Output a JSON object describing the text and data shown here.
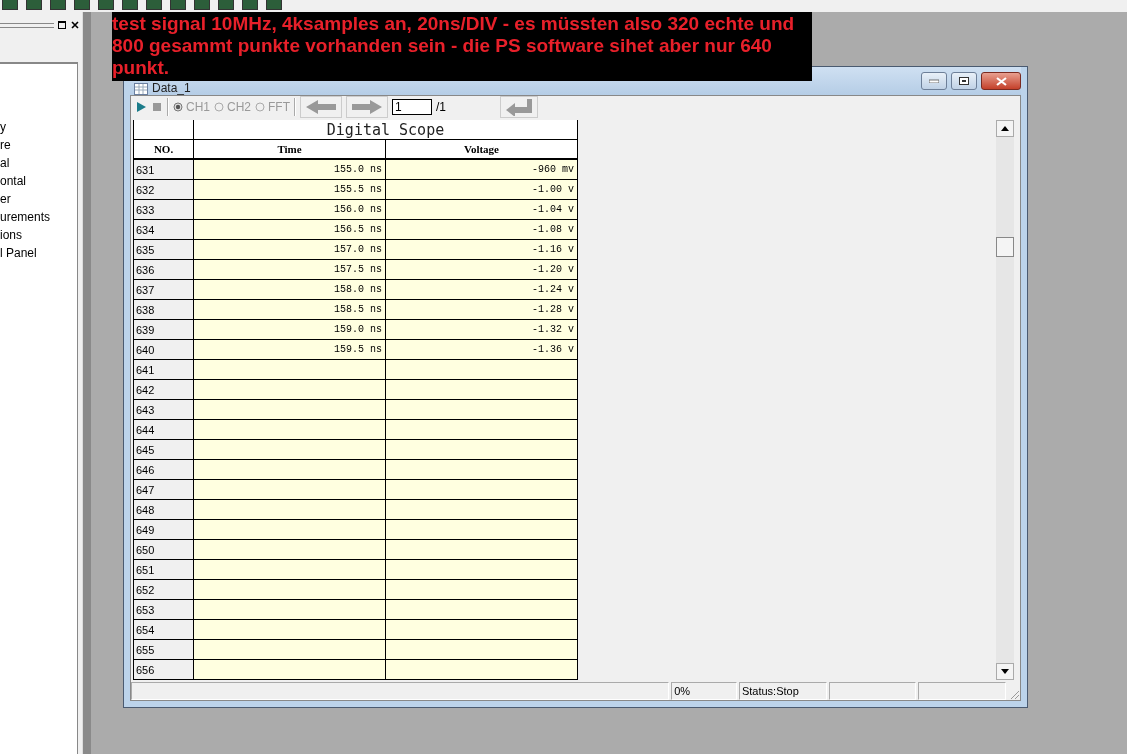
{
  "note": {
    "text": "test signal 10MHz, 4ksamples an, 20ns/DIV - es müssten also 320 echte und 800 gesammt punkte vorhanden sein - die PS software sihet aber nur 640 punkt."
  },
  "sidebar": {
    "items": [
      "y",
      "re",
      "al",
      "ontal",
      "er",
      "urements",
      "ions",
      "l Panel"
    ]
  },
  "window": {
    "title": "Data_1",
    "toolbar": {
      "channels": [
        {
          "label": "CH1",
          "selected": true
        },
        {
          "label": "CH2",
          "selected": false
        },
        {
          "label": "FFT",
          "selected": false
        }
      ],
      "page_value": "1",
      "page_total": "/1"
    },
    "table": {
      "title": "Digital Scope",
      "columns": [
        "NO.",
        "Time",
        "Voltage"
      ],
      "rows": [
        {
          "no": "631",
          "time": "155.0 ns",
          "voltage": "-960 mv"
        },
        {
          "no": "632",
          "time": "155.5 ns",
          "voltage": "-1.00 v"
        },
        {
          "no": "633",
          "time": "156.0 ns",
          "voltage": "-1.04 v"
        },
        {
          "no": "634",
          "time": "156.5 ns",
          "voltage": "-1.08 v"
        },
        {
          "no": "635",
          "time": "157.0 ns",
          "voltage": "-1.16 v"
        },
        {
          "no": "636",
          "time": "157.5 ns",
          "voltage": "-1.20 v"
        },
        {
          "no": "637",
          "time": "158.0 ns",
          "voltage": "-1.24 v"
        },
        {
          "no": "638",
          "time": "158.5 ns",
          "voltage": "-1.28 v"
        },
        {
          "no": "639",
          "time": "159.0 ns",
          "voltage": "-1.32 v"
        },
        {
          "no": "640",
          "time": "159.5 ns",
          "voltage": "-1.36 v"
        },
        {
          "no": "641"
        },
        {
          "no": "642"
        },
        {
          "no": "643"
        },
        {
          "no": "644"
        },
        {
          "no": "645"
        },
        {
          "no": "646"
        },
        {
          "no": "647"
        },
        {
          "no": "648"
        },
        {
          "no": "649"
        },
        {
          "no": "650"
        },
        {
          "no": "651"
        },
        {
          "no": "652"
        },
        {
          "no": "653"
        },
        {
          "no": "654"
        },
        {
          "no": "655"
        },
        {
          "no": "656"
        }
      ]
    },
    "status_bar": [
      "0%",
      "Status:Stop"
    ]
  }
}
